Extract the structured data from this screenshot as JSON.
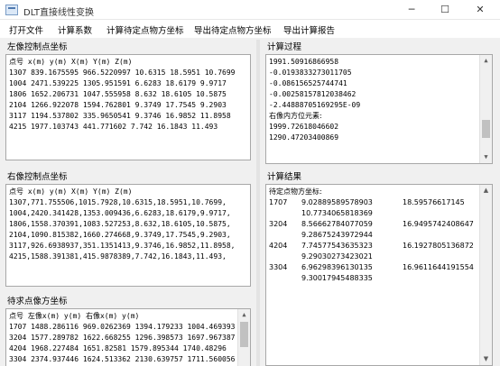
{
  "window": {
    "title": "DLT直接线性变换",
    "minimize": "─",
    "maximize": "☐",
    "close": "✕"
  },
  "menu": [
    "打开文件",
    "计算系数",
    "计算待定点物方坐标",
    "导出待定点物方坐标",
    "导出计算报告"
  ],
  "left_control": {
    "label": "左像控制点坐标",
    "lines": [
      "点号 x(m) y(m) X(m) Y(m) Z(m)",
      "1307 839.1675595 966.5220997 10.6315 18.5951 10.7699",
      "1004 2471.539225 1305.951591 6.6283 18.6179 9.9717",
      "1806 1652.206731 1047.555958 8.632 18.6105 10.5875",
      "2104 1266.922078 1594.762801 9.3749 17.7545 9.2903",
      "3117 1194.537802 335.9650541 9.3746 16.9852 11.8958",
      "4215 1977.103743 441.771602 7.742 16.1843 11.493"
    ]
  },
  "right_control": {
    "label": "右像控制点坐标",
    "lines": [
      "点号 x(m) y(m) X(m) Y(m) Z(m)",
      "1307,771.755506,1015.7928,10.6315,18.5951,10.7699,",
      "1004,2420.341428,1353.009436,6.6283,18.6179,9.9717,",
      "1806,1558.370391,1083.527253,8.632,18.6105,10.5875,",
      "2104,1090.815382,1660.274668,9.3749,17.7545,9.2903,",
      "3117,926.6938937,351.1351413,9.3746,16.9852,11.8958,",
      "4215,1588.391381,415.9878389,7.742,16.1843,11.493,"
    ]
  },
  "pending": {
    "label": "待求点像方坐标",
    "lines": [
      "点号 左像x(m) y(m) 右像x(m) y(m)",
      "1707 1488.286116 969.0262369 1394.179233 1004.469393",
      "3204 1577.289782 1622.668255 1296.398573 1697.967387",
      "4204 1968.227484 1651.82581 1579.895344 1740.48296",
      "3304 2374.937446 1624.513362 2130.639757 1711.560056"
    ]
  },
  "process": {
    "label": "计算过程",
    "lines": [
      "1991.50916866958",
      "-0.0193833273011705",
      "-0.086156525744741",
      "-0.00258157812038462",
      "-2.44888705169295E-09",
      "右像内方位元素:",
      "1999.72618046602",
      "1290.47203400869"
    ]
  },
  "result": {
    "label": "计算结果",
    "heading": "待定点物方坐标:",
    "rows": [
      {
        "id": "1707",
        "x": "9.02889589578903",
        "y": "18.59576617145",
        "z": "10.7734065818369"
      },
      {
        "id": "3204",
        "x": "8.56662784077059",
        "y": "16.9495742408647",
        "z": "9.28675243972944"
      },
      {
        "id": "4204",
        "x": "7.74577543635323",
        "y": "16.1927805136872",
        "z": "9.29030273423021"
      },
      {
        "id": "3304",
        "x": "6.96298396130135",
        "y": "16.9611644191554",
        "z": "9.30017945488335"
      }
    ]
  }
}
